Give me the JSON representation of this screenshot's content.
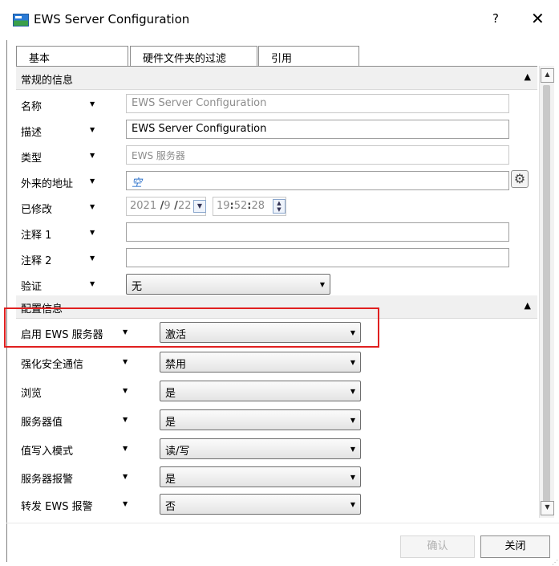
{
  "window": {
    "title": "EWS Server Configuration",
    "help_label": "?",
    "close_label": "✕"
  },
  "tabs": [
    "基本",
    "硬件文件夹的过滤",
    "引用"
  ],
  "sections": {
    "general": {
      "title": "常规的信息",
      "rows": [
        {
          "label": "名称",
          "value": "EWS Server Configuration",
          "state": "disabled"
        },
        {
          "label": "描述",
          "value": "EWS Server Configuration",
          "state": "enabled"
        },
        {
          "label": "类型",
          "value": "EWS 服务器",
          "state": "disabled"
        },
        {
          "label": "外来的地址",
          "value": "空"
        },
        {
          "label": "已修改",
          "date": {
            "year": "2021",
            "month": "9",
            "day": "22"
          },
          "time": {
            "h": "19",
            "m": "52",
            "s": "28"
          }
        },
        {
          "label": "注释 1",
          "value": ""
        },
        {
          "label": "注释 2",
          "value": ""
        },
        {
          "label": "验证",
          "value": "无"
        }
      ]
    },
    "config": {
      "title": "配置信息",
      "rows": [
        {
          "label": "启用 EWS 服务器",
          "value": "激活"
        },
        {
          "label": "强化安全通信",
          "value": "禁用"
        },
        {
          "label": "浏览",
          "value": "是"
        },
        {
          "label": "服务器值",
          "value": "是"
        },
        {
          "label": "值写入模式",
          "value": "读/写"
        },
        {
          "label": "服务器报警",
          "value": "是"
        },
        {
          "label": "转发 EWS 报警",
          "value": "否"
        }
      ]
    }
  },
  "buttons": {
    "ok": "确认",
    "close": "关闭"
  },
  "colors": {
    "highlight_box": "#e02020",
    "disabled_text": "#8c8c8c",
    "link_blue": "#2a6fc9"
  },
  "icons": {
    "app": "ews-app-icon",
    "gear": "gear-icon",
    "row_dropdown": "chevron-down-icon",
    "collapse": "chevron-up-icon"
  }
}
